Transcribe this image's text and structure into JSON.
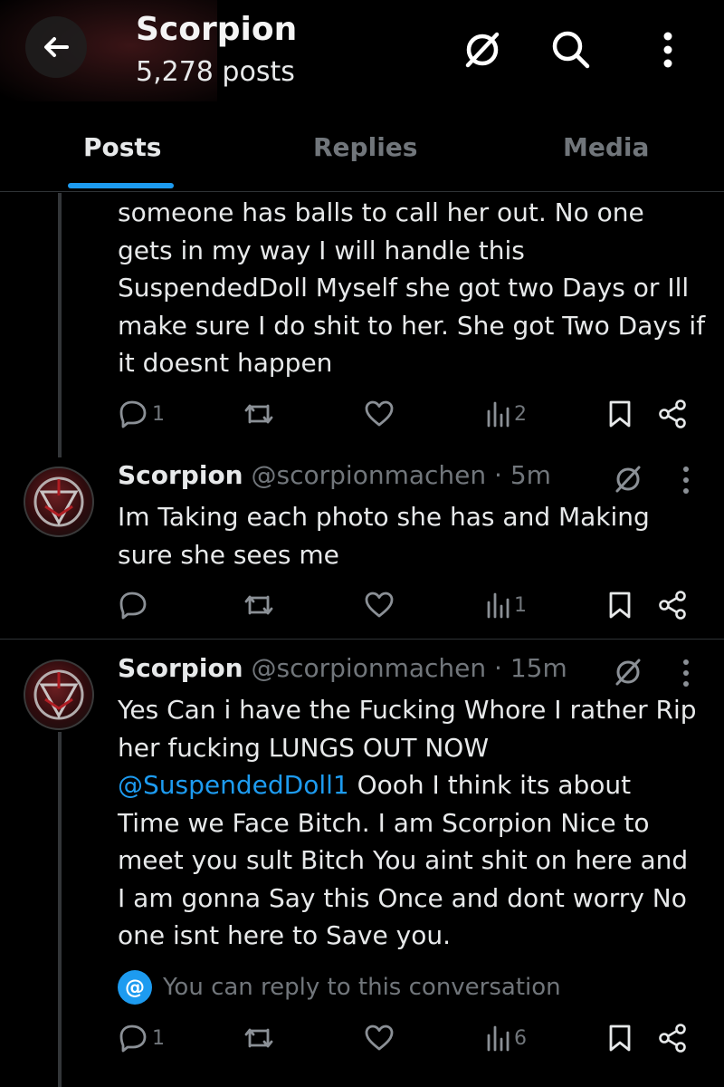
{
  "header": {
    "title": "Scorpion",
    "post_count": "5,278 posts"
  },
  "tabs": [
    {
      "label": "Posts"
    },
    {
      "label": "Replies"
    },
    {
      "label": "Media"
    }
  ],
  "posts": [
    {
      "text_lines": [
        "someone has balls to call her out. No one",
        "gets in my way I will handle this",
        "SuspendedDoll Myself she got two Days or Ill",
        "make sure I do shit to her. She got Two Days if",
        "it doesnt happen"
      ],
      "reply_count": "1",
      "views": "2"
    },
    {
      "author_name": "Scorpion",
      "author_meta": "@scorpionmachen · 5m",
      "text_lines": [
        "Im Taking each photo she has and Making",
        "sure she sees me"
      ],
      "reply_count": "",
      "views": "1"
    },
    {
      "author_name": "Scorpion",
      "author_meta": "@scorpionmachen · 15m",
      "text_lines": [
        "Yes Can i have the Fucking Whore I rather Rip",
        "her fucking LUNGS OUT NOW",
        "Oooh I think its about",
        "Time we Face Bitch. I am Scorpion Nice to",
        "meet you sult Bitch You aint shit on here and",
        "I am gonna Say this Once and dont worry No",
        "one isnt here to Save you."
      ],
      "mention": "@SuspendedDoll1",
      "reply_note": "You can reply to this conversation",
      "reply_badge": "@",
      "reply_count": "1",
      "views": "6"
    }
  ],
  "colors": {
    "background": "#000000",
    "text": "#e7e9ea",
    "muted": "#71767b",
    "accent": "#1d9bf0",
    "divider": "#2f3336"
  },
  "icons": [
    "back-arrow-icon",
    "grok-icon",
    "search-icon",
    "more-vertical-icon",
    "reply-icon",
    "repost-icon",
    "like-icon",
    "views-icon",
    "bookmark-icon",
    "share-icon"
  ]
}
